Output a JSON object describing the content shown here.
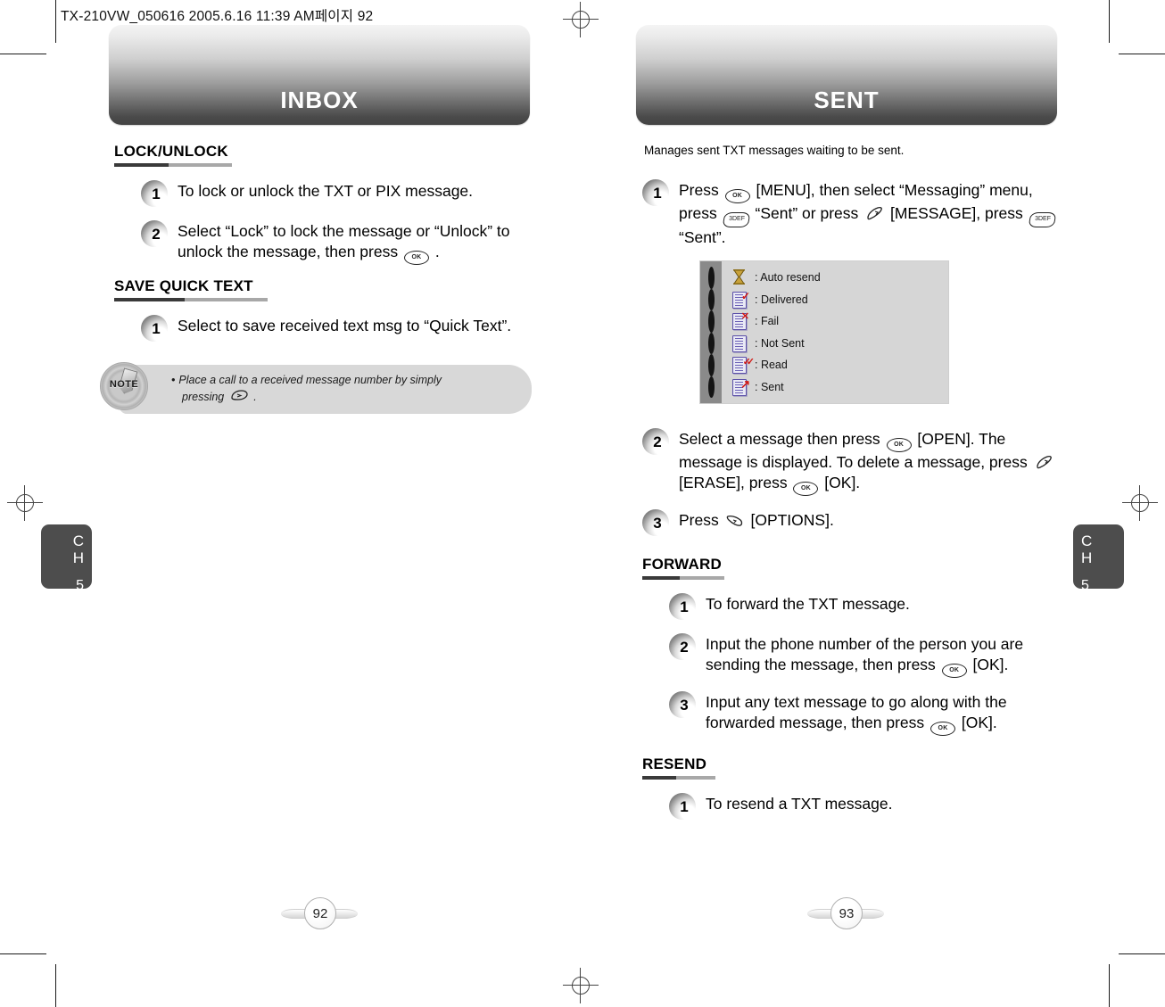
{
  "doc_meta": "TX-210VW_050616  2005.6.16 11:39 AM페이지 92",
  "left_page": {
    "banner_title": "INBOX",
    "chapter": {
      "letters": "CH",
      "number": "5"
    },
    "page_number": "92",
    "sections": [
      {
        "title": "LOCK/UNLOCK",
        "steps": [
          {
            "num": "1",
            "parts": [
              {
                "t": "text",
                "v": "To lock or unlock the TXT or PIX message."
              }
            ]
          },
          {
            "num": "2",
            "parts": [
              {
                "t": "text",
                "v": "Select “Lock” to lock the message or “Unlock” to unlock the message, then press "
              },
              {
                "t": "key",
                "v": "ok-key"
              },
              {
                "t": "text",
                "v": " ."
              }
            ]
          }
        ]
      },
      {
        "title": "SAVE QUICK TEXT",
        "steps": [
          {
            "num": "1",
            "parts": [
              {
                "t": "text",
                "v": "Select to save received text msg to “Quick Text”."
              }
            ]
          }
        ]
      }
    ],
    "note": {
      "badge_label": "NOTE",
      "bullet": "•",
      "line1": "Place a call to a received message number by simply",
      "line2_pre": "pressing",
      "line2_key": "send-key",
      "line2_post": "."
    }
  },
  "right_page": {
    "banner_title": "SENT",
    "chapter": {
      "letters": "CH",
      "number": "5"
    },
    "page_number": "93",
    "intro": "Manages sent TXT messages waiting to be sent.",
    "step1": {
      "num": "1",
      "parts": [
        {
          "t": "text",
          "v": "Press "
        },
        {
          "t": "key",
          "v": "ok-key"
        },
        {
          "t": "text",
          "v": " [MENU], then select “Messaging” menu, press "
        },
        {
          "t": "key",
          "v": "three-key"
        },
        {
          "t": "text",
          "v": " “Sent” or press "
        },
        {
          "t": "key",
          "v": "message-key"
        },
        {
          "t": "text",
          "v": " [MESSAGE], press "
        },
        {
          "t": "key",
          "v": "three-key"
        },
        {
          "t": "text",
          "v": " “Sent”."
        }
      ]
    },
    "legend": [
      {
        "icon": "hourglass-icon",
        "label": ": Auto resend"
      },
      {
        "icon": "document-check-icon",
        "label": ": Delivered"
      },
      {
        "icon": "document-x-icon",
        "label": ": Fail"
      },
      {
        "icon": "document-plain-icon",
        "label": ": Not Sent"
      },
      {
        "icon": "document-double-check-icon",
        "label": ": Read"
      },
      {
        "icon": "document-arrow-icon",
        "label": ": Sent"
      }
    ],
    "steps_after_legend": [
      {
        "num": "2",
        "parts": [
          {
            "t": "text",
            "v": "Select a message then press "
          },
          {
            "t": "key",
            "v": "ok-key"
          },
          {
            "t": "text",
            "v": " [OPEN]. The message is displayed. To delete a message, press "
          },
          {
            "t": "key",
            "v": "message-key"
          },
          {
            "t": "text",
            "v": " [ERASE], press "
          },
          {
            "t": "key",
            "v": "ok-key"
          },
          {
            "t": "text",
            "v": " [OK]."
          }
        ]
      },
      {
        "num": "3",
        "parts": [
          {
            "t": "text",
            "v": "Press "
          },
          {
            "t": "key",
            "v": "options-key"
          },
          {
            "t": "text",
            "v": " [OPTIONS]."
          }
        ]
      }
    ],
    "sections": [
      {
        "title": "FORWARD",
        "steps": [
          {
            "num": "1",
            "parts": [
              {
                "t": "text",
                "v": "To forward the TXT message."
              }
            ]
          },
          {
            "num": "2",
            "parts": [
              {
                "t": "text",
                "v": "Input the phone number of the person you are sending the message, then press "
              },
              {
                "t": "key",
                "v": "ok-key"
              },
              {
                "t": "text",
                "v": " [OK]."
              }
            ]
          },
          {
            "num": "3",
            "parts": [
              {
                "t": "text",
                "v": "Input any text message to go along with the forwarded message, then press "
              },
              {
                "t": "key",
                "v": "ok-key"
              },
              {
                "t": "text",
                "v": " [OK]."
              }
            ]
          }
        ]
      },
      {
        "title": "RESEND",
        "steps": [
          {
            "num": "1",
            "parts": [
              {
                "t": "text",
                "v": "To resend a TXT message."
              }
            ]
          }
        ]
      }
    ]
  },
  "keys": {
    "ok-key": "OK",
    "three-key": "3DEF"
  },
  "colors": {
    "banner_dark": "#434343",
    "chapter_tab": "#4d4d4d",
    "rule_dark": "#3a3a3a",
    "rule_light": "#a8a8a8",
    "note_bg": "#d8d8d8",
    "legend_bg": "#d6d6d6",
    "legend_strip": "#8a8a8a",
    "icon_purple": "#5b4fa8",
    "icon_red": "#d21b16"
  }
}
